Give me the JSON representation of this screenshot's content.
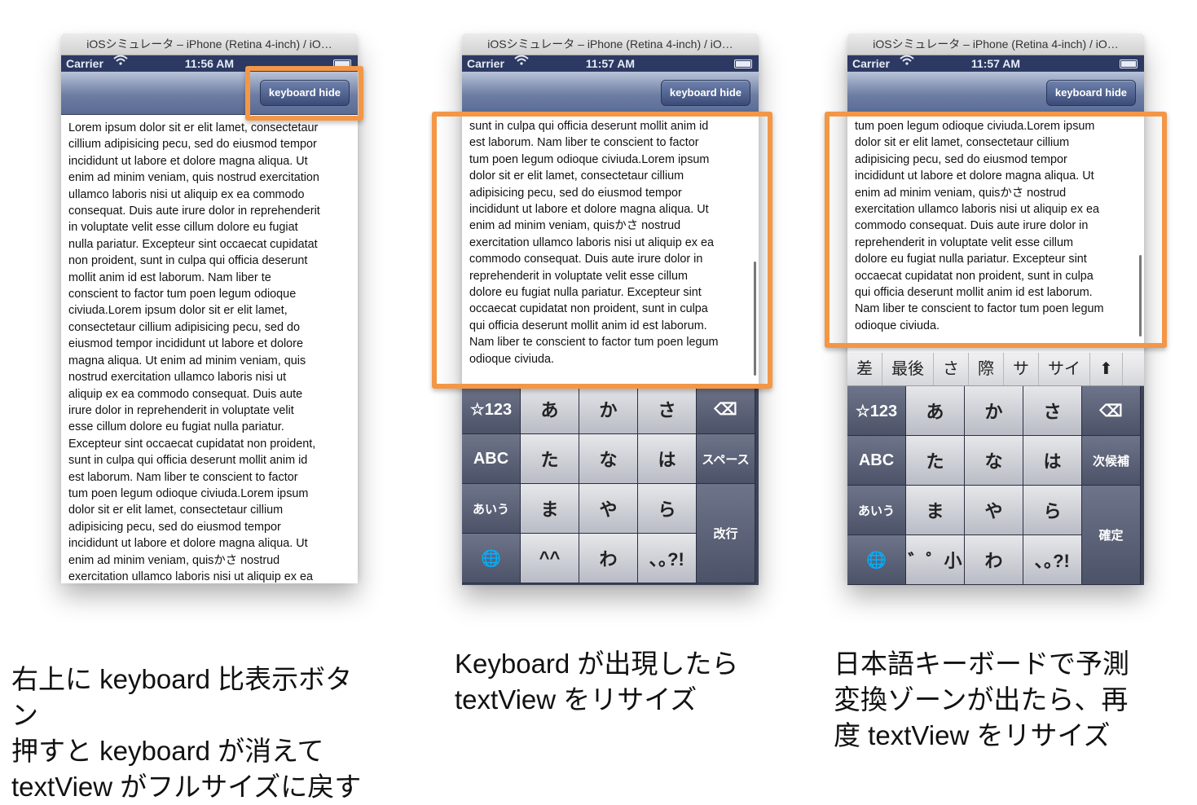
{
  "panels": [
    {
      "window_title": "iOSシミュレータ – iPhone (Retina 4-inch) / iO…",
      "status": {
        "carrier": "Carrier",
        "time": "11:56 AM"
      },
      "button_label": "keyboard hide",
      "text_lines": [
        "Lorem ipsum dolor sit er elit lamet, consectetaur",
        "cillium adipisicing pecu, sed do eiusmod tempor",
        "incididunt ut labore et dolore magna aliqua. Ut",
        "enim ad minim veniam, quis nostrud exercitation",
        "ullamco laboris nisi ut aliquip ex ea commodo",
        "consequat. Duis aute irure dolor in reprehenderit",
        "in voluptate velit esse cillum dolore eu fugiat",
        "nulla pariatur. Excepteur sint occaecat cupidatat",
        "non proident, sunt in culpa qui officia deserunt",
        "mollit anim id est laborum. Nam liber te",
        "conscient to factor tum poen legum odioque",
        "civiuda.Lorem ipsum dolor sit er elit lamet,",
        "consectetaur cillium adipisicing pecu, sed do",
        "eiusmod tempor incididunt ut labore et dolore",
        "magna aliqua. Ut enim ad minim veniam, quis",
        "nostrud exercitation ullamco laboris nisi ut",
        "aliquip ex ea commodo consequat. Duis aute",
        "irure dolor in reprehenderit in voluptate velit",
        "esse cillum dolore eu fugiat nulla pariatur.",
        "Excepteur sint occaecat cupidatat non proident,",
        "sunt in culpa qui officia deserunt mollit anim id",
        "est laborum. Nam liber te conscient to factor",
        "tum poen legum odioque civiuda.Lorem ipsum",
        "dolor sit er elit lamet, consectetaur cillium",
        "adipisicing pecu, sed do eiusmod tempor",
        "incididunt ut labore et dolore magna aliqua. Ut",
        "enim ad minim veniam, quisかさ nostrud",
        "exercitation ullamco laboris nisi ut aliquip ex ea"
      ],
      "caption_lines": [
        "右上に keyboard 比表示ボタ",
        "ン",
        "押すと keyboard が消えて",
        "textView がフルサイズに戻す"
      ]
    },
    {
      "window_title": "iOSシミュレータ – iPhone (Retina 4-inch) / iO…",
      "status": {
        "carrier": "Carrier",
        "time": "11:57 AM"
      },
      "button_label": "keyboard hide",
      "text_lines": [
        "sunt in culpa qui officia deserunt mollit anim id",
        "est laborum. Nam liber te conscient to factor",
        "tum poen legum odioque civiuda.Lorem ipsum",
        "dolor sit er elit lamet, consectetaur cillium",
        "adipisicing pecu, sed do eiusmod tempor",
        "incididunt ut labore et dolore magna aliqua. Ut",
        "enim ad minim veniam, quisかさ nostrud",
        "exercitation ullamco laboris nisi ut aliquip ex ea",
        "commodo consequat. Duis aute irure dolor in",
        "reprehenderit in voluptate velit esse cillum",
        "dolore eu fugiat nulla pariatur. Excepteur sint",
        "occaecat cupidatat non proident, sunt in culpa",
        "qui officia deserunt mollit anim id est laborum.",
        "Nam liber te conscient to factor tum poen legum",
        "odioque civiuda."
      ],
      "keyboard": {
        "rows": [
          [
            "☆123",
            "あ",
            "か",
            "さ",
            "⌫"
          ],
          [
            "ABC",
            "た",
            "な",
            "は",
            "スペース"
          ],
          [
            "あいう",
            "ま",
            "や",
            "ら",
            "改行"
          ],
          [
            "🌐",
            "^^",
            "わ",
            "､｡?!"
          ]
        ]
      },
      "caption_lines": [
        "Keyboard が出現したら",
        "textView をリサイズ"
      ]
    },
    {
      "window_title": "iOSシミュレータ – iPhone (Retina 4-inch) / iO…",
      "status": {
        "carrier": "Carrier",
        "time": "11:57 AM"
      },
      "button_label": "keyboard hide",
      "text_lines": [
        "tum poen legum odioque civiuda.Lorem ipsum",
        "dolor sit er elit lamet, consectetaur cillium",
        "adipisicing pecu, sed do eiusmod tempor",
        "incididunt ut labore et dolore magna aliqua. Ut",
        "enim ad minim veniam, quisかさ nostrud",
        "exercitation ullamco laboris nisi ut aliquip ex ea",
        "commodo consequat. Duis aute irure dolor in",
        "reprehenderit in voluptate velit esse cillum",
        "dolore eu fugiat nulla pariatur. Excepteur sint",
        "occaecat cupidatat non proident, sunt in culpa",
        "qui officia deserunt mollit anim id est laborum.",
        "Nam liber te conscient to factor tum poen legum",
        "odioque civiuda."
      ],
      "candidates": [
        "差",
        "最後",
        "さ",
        "際",
        "サ",
        "サイ",
        "⬆"
      ],
      "keyboard": {
        "rows": [
          [
            "☆123",
            "あ",
            "か",
            "さ",
            "⌫"
          ],
          [
            "ABC",
            "た",
            "な",
            "は",
            "次候補"
          ],
          [
            "あいう",
            "ま",
            "や",
            "ら",
            "確定"
          ],
          [
            "🌐",
            "゛゜小",
            "わ",
            "､｡?!"
          ]
        ]
      },
      "caption_lines": [
        "日本語キーボードで予測",
        "変換ゾーンが出たら、再",
        "度 textView をリサイズ"
      ]
    }
  ],
  "colors": {
    "highlight": "#f39746",
    "keyboard_bg": "#3c4258",
    "navbar": "#5a6b94"
  }
}
